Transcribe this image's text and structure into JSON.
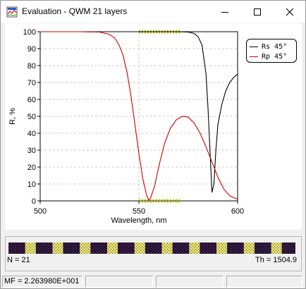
{
  "window": {
    "title": "Evaluation - QWM 21 layers",
    "controls": {
      "minimize": "minimize-icon",
      "maximize": "maximize-icon",
      "close": "close-icon"
    }
  },
  "chart_data": {
    "type": "line",
    "title": "",
    "xlabel": "Wavelength, nm",
    "ylabel": "R, %",
    "xlim": [
      500,
      600
    ],
    "ylim": [
      0,
      100
    ],
    "xticks": [
      "500",
      "550",
      "600"
    ],
    "yticks": [
      "0",
      "10",
      "20",
      "30",
      "40",
      "50",
      "60",
      "70",
      "80",
      "90",
      "100"
    ],
    "grid": true,
    "legend_position": "top-right",
    "series": [
      {
        "name": "Rs 45°",
        "color": "#000000",
        "x": [
          500,
          510,
          520,
          530,
          540,
          550,
          560,
          570,
          575,
          578,
          580,
          582,
          584,
          585,
          586,
          587,
          588,
          589,
          590,
          592,
          594,
          596,
          598,
          600
        ],
        "y": [
          100,
          100,
          100,
          100,
          100,
          100,
          100,
          100,
          99.8,
          99,
          97,
          92,
          75,
          55,
          30,
          5,
          10,
          30,
          45,
          57,
          65,
          70,
          73,
          75
        ]
      },
      {
        "name": "Rp 45°",
        "color": "#cc0000",
        "x": [
          500,
          520,
          530,
          535,
          538,
          540,
          542,
          544,
          546,
          548,
          550,
          552,
          554,
          555,
          556,
          558,
          560,
          563,
          566,
          569,
          572,
          575,
          578,
          581,
          584,
          587,
          590,
          593,
          596,
          600
        ],
        "y": [
          100,
          100,
          99.8,
          98.5,
          96,
          92,
          86,
          76,
          62,
          45,
          28,
          13,
          3,
          0.5,
          2,
          9,
          20,
          34,
          43,
          48,
          50,
          49.5,
          46,
          40,
          32,
          23,
          14,
          7,
          3,
          1
        ]
      }
    ]
  },
  "design": {
    "layer_count_label": "N = 21",
    "thickness_label": "Th = 1504.9"
  },
  "status": {
    "merit": "MF = 2.263980E+001"
  }
}
